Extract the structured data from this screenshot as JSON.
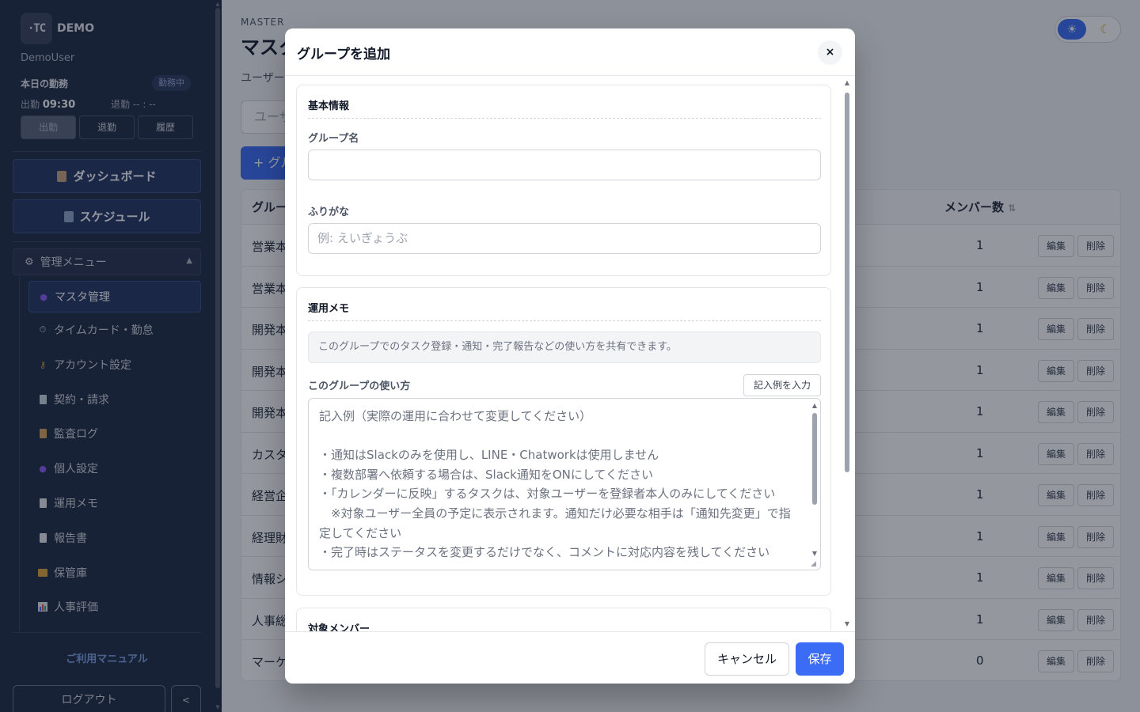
{
  "sidebar": {
    "logo_text": "·TC",
    "brand": "DEMO",
    "username": "DemoUser",
    "today_label": "本日の勤務",
    "status_badge": "勤務中",
    "clock_in_label": "出勤",
    "clock_in_time": "09:30",
    "clock_out_label": "退勤",
    "clock_out_time": "-- : --",
    "buttons": {
      "in": "出勤",
      "out": "退勤",
      "history": "履歴"
    },
    "dashboard": "ダッシュボード",
    "schedule": "スケジュール",
    "admin_menu": "管理メニュー",
    "items": [
      {
        "label": "マスタ管理",
        "icon": "people-icon"
      },
      {
        "label": "タイムカード・勤怠",
        "icon": "stopwatch-icon"
      },
      {
        "label": "アカウント設定",
        "icon": "key-icon"
      },
      {
        "label": "契約・請求",
        "icon": "document-icon"
      },
      {
        "label": "監査ログ",
        "icon": "ledger-icon"
      },
      {
        "label": "個人設定",
        "icon": "person-icon"
      },
      {
        "label": "運用メモ",
        "icon": "memo-icon"
      },
      {
        "label": "報告書",
        "icon": "report-icon"
      },
      {
        "label": "保管庫",
        "icon": "folder-icon"
      },
      {
        "label": "人事評価",
        "icon": "bar-chart-icon"
      }
    ],
    "manual": "ご利用マニュアル",
    "logout": "ログアウト"
  },
  "main": {
    "section_label": "MASTER",
    "title": "マスタ",
    "subtitle": "ユーザー",
    "search_placeholder": "ユーザ",
    "add_button": "+ グル",
    "table": {
      "col_group": "グルー",
      "col_members": "メンバー数",
      "edit": "編集",
      "delete": "削除",
      "rows": [
        {
          "name": "営業本",
          "count": "1"
        },
        {
          "name": "営業本",
          "count": "1"
        },
        {
          "name": "開発本",
          "count": "1"
        },
        {
          "name": "開発本",
          "count": "1"
        },
        {
          "name": "開発本",
          "count": "1"
        },
        {
          "name": "カスタ",
          "count": "1"
        },
        {
          "name": "経営企",
          "count": "1"
        },
        {
          "name": "経理財",
          "count": "1"
        },
        {
          "name": "情報シ",
          "count": "1"
        },
        {
          "name": "人事総",
          "count": "1"
        },
        {
          "name": "マーケ",
          "count": "0"
        }
      ]
    }
  },
  "modal": {
    "title": "グループを追加",
    "close": "×",
    "basic": {
      "title": "基本情報",
      "name_label": "グループ名",
      "name_value": "",
      "furigana_label": "ふりがな",
      "furigana_placeholder": "例: えいぎょうぶ"
    },
    "memo": {
      "title": "運用メモ",
      "note": "このグループでのタスク登録・通知・完了報告などの使い方を共有できます。",
      "usage_label": "このグループの使い方",
      "example_button": "記入例を入力",
      "usage_placeholder": "記入例（実際の運用に合わせて変更してください）\n\n・通知はSlackのみを使用し、LINE・Chatworkは使用しません\n・複数部署へ依頼する場合は、Slack通知をONにしてください\n・「カレンダーに反映」するタスクは、対象ユーザーを登録者本人のみにしてください\n　※対象ユーザー全員の予定に表示されます。通知だけ必要な相手は「通知先変更」で指定してください\n・完了時はステータスを変更するだけでなく、コメントに対応内容を残してください"
    },
    "members": {
      "title": "対象メンバー"
    },
    "cancel": "キャンセル",
    "save": "保存"
  }
}
